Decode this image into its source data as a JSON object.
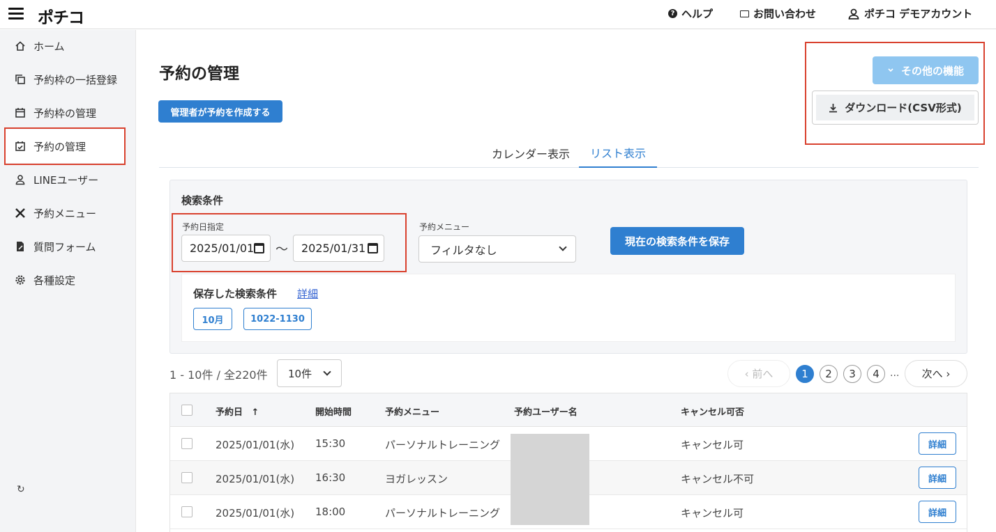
{
  "header": {
    "logo": "ポチコ",
    "help": "ヘルプ",
    "contact": "お問い合わせ",
    "account": "ポチコ デモアカウント"
  },
  "sidebar": {
    "items": [
      {
        "label": "ホーム",
        "icon": "home-icon"
      },
      {
        "label": "予約枠の一括登録",
        "icon": "copy-icon"
      },
      {
        "label": "予約枠の管理",
        "icon": "calendar-icon"
      },
      {
        "label": "予約の管理",
        "icon": "calendar-check-icon"
      },
      {
        "label": "LINEユーザー",
        "icon": "user-icon"
      },
      {
        "label": "予約メニュー",
        "icon": "utensils-icon"
      },
      {
        "label": "質問フォーム",
        "icon": "form-icon"
      },
      {
        "label": "各種設定",
        "icon": "gear-icon"
      }
    ],
    "refresh_icon": "↻"
  },
  "page": {
    "title": "予約の管理",
    "create_button": "管理者が予約を作成する",
    "other_features_button": "その他の機能",
    "download_item": "ダウンロード(CSV形式)"
  },
  "tabs": [
    {
      "label": "カレンダー表示"
    },
    {
      "label": "リスト表示"
    }
  ],
  "search": {
    "title": "検索条件",
    "date_label": "予約日指定",
    "date_from": "2025/01/01",
    "date_separator": "〜",
    "date_to": "2025/01/31",
    "menu_label": "予約メニュー",
    "menu_value": "フィルタなし",
    "save_button": "現在の検索条件を保存",
    "saved_title": "保存した検索条件",
    "saved_detail_link": "詳細",
    "saved_chips": [
      "10月",
      "1022-1130"
    ]
  },
  "pagination": {
    "count_text": "1 - 10件 / 全220件",
    "per_page": "10件",
    "prev": "‹ 前へ",
    "next": "次へ ›",
    "pages": [
      "1",
      "2",
      "3",
      "4"
    ],
    "ellipsis": "..."
  },
  "table": {
    "headers": {
      "date": "予約日",
      "sort_indicator": "↑",
      "start_time": "開始時間",
      "menu": "予約メニュー",
      "user": "予約ユーザー名",
      "cancel": "キャンセル可否"
    },
    "detail_label": "詳細",
    "rows": [
      {
        "date": "2025/01/01(水)",
        "time": "15:30",
        "menu": "パーソナルトレーニング",
        "cancel": "キャンセル可"
      },
      {
        "date": "2025/01/01(水)",
        "time": "16:30",
        "menu": "ヨガレッスン",
        "cancel": "キャンセル不可"
      },
      {
        "date": "2025/01/01(水)",
        "time": "18:00",
        "menu": "パーソナルトレーニング",
        "cancel": "キャンセル可"
      }
    ]
  },
  "colors": {
    "accent": "#2f7fd0",
    "accent_light": "#8fc6f0",
    "highlight": "#d9412e"
  }
}
